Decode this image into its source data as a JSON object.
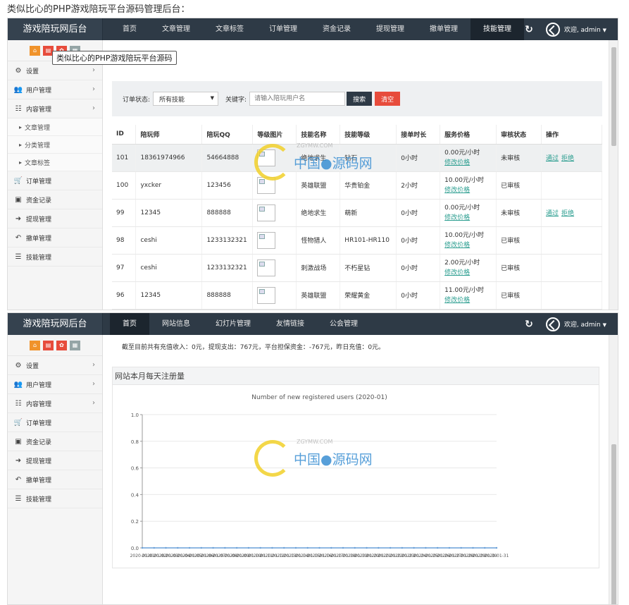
{
  "page": {
    "heading": "类似比心的PHP游戏陪玩平台源码管理后台："
  },
  "app": {
    "brand": "游戏陪玩网后台",
    "welcome": "欢迎, admin",
    "caret": "▼"
  },
  "shot1": {
    "nav": [
      "首页",
      "文章管理",
      "文章标签",
      "订单管理",
      "资金记录",
      "提现管理",
      "撤单管理",
      "技能管理"
    ],
    "active_nav": 7,
    "tooltip": "类似比心的PHP游戏陪玩平台源码",
    "sidebar": [
      {
        "label": "设置",
        "icon": "⚙"
      },
      {
        "label": "用户管理",
        "icon": "👥"
      },
      {
        "label": "内容管理",
        "icon": "☷"
      }
    ],
    "subitems": [
      "文章管理",
      "分类管理",
      "文章标签"
    ],
    "sidebar_rest": [
      {
        "label": "订单管理",
        "icon": "🛒"
      },
      {
        "label": "资金记录",
        "icon": "▣"
      },
      {
        "label": "提现管理",
        "icon": "➜"
      },
      {
        "label": "撤单管理",
        "icon": "↶"
      },
      {
        "label": "技能管理",
        "icon": "☰"
      }
    ],
    "filter": {
      "status_label": "订单状态:",
      "status_value": "所有技能",
      "keyword_label": "关键字:",
      "keyword_placeholder": "请输入陪玩用户名",
      "search_btn": "搜索",
      "clear_btn": "清空"
    },
    "table": {
      "headers": [
        "ID",
        "陪玩师",
        "陪玩QQ",
        "等级图片",
        "技能名称",
        "技能等级",
        "接单时长",
        "服务价格",
        "审核状态",
        "操作"
      ],
      "rows": [
        {
          "id": "101",
          "player": "18361974966",
          "qq": "54664888",
          "skill": "绝地求生",
          "level": "钻石",
          "duration": "0小时",
          "price": "0.00元/小时",
          "edit": "修改价格",
          "status": "未审核",
          "ops": [
            "通过",
            "拒绝"
          ]
        },
        {
          "id": "100",
          "player": "yxcker",
          "qq": "123456",
          "skill": "英雄联盟",
          "level": "华贵铂金",
          "duration": "2小时",
          "price": "10.00元/小时",
          "edit": "修改价格",
          "status": "已审核",
          "ops": []
        },
        {
          "id": "99",
          "player": "12345",
          "qq": "888888",
          "skill": "绝地求生",
          "level": "萌新",
          "duration": "0小时",
          "price": "0.00元/小时",
          "edit": "修改价格",
          "status": "未审核",
          "ops": [
            "通过",
            "拒绝"
          ]
        },
        {
          "id": "98",
          "player": "ceshi",
          "qq": "1233132321",
          "skill": "怪物猎人",
          "level": "HR101-HR110",
          "duration": "0小时",
          "price": "10.00元/小时",
          "edit": "修改价格",
          "status": "已审核",
          "ops": []
        },
        {
          "id": "97",
          "player": "ceshi",
          "qq": "1233132321",
          "skill": "刺激战场",
          "level": "不朽星钻",
          "duration": "0小时",
          "price": "2.00元/小时",
          "edit": "修改价格",
          "status": "已审核",
          "ops": []
        },
        {
          "id": "96",
          "player": "12345",
          "qq": "888888",
          "skill": "英雄联盟",
          "level": "荣耀黄金",
          "duration": "0小时",
          "price": "11.00元/小时",
          "edit": "修改价格",
          "status": "已审核",
          "ops": []
        }
      ]
    }
  },
  "shot2": {
    "nav": [
      "首页",
      "网站信息",
      "幻灯片管理",
      "友情链接",
      "公会管理"
    ],
    "active_nav": 0,
    "sidebar": [
      {
        "label": "设置",
        "icon": "⚙"
      },
      {
        "label": "用户管理",
        "icon": "👥"
      },
      {
        "label": "内容管理",
        "icon": "☷"
      },
      {
        "label": "订单管理",
        "icon": "🛒"
      },
      {
        "label": "资金记录",
        "icon": "▣"
      },
      {
        "label": "提现管理",
        "icon": "➜"
      },
      {
        "label": "撤单管理",
        "icon": "↶"
      },
      {
        "label": "技能管理",
        "icon": "☰"
      }
    ],
    "summary": "截至目前共有充值收入：0元，提现支出：767元，平台担保资金：-767元，昨日充值：0元。",
    "panel_title": "网站本月每天注册量"
  },
  "chart_data": {
    "type": "line",
    "title": "Number of new registered users (2020-01)",
    "x": [
      "2020-01-01",
      "2020-01-02",
      "2020-01-03",
      "2020-01-04",
      "2020-01-05",
      "2020-01-06",
      "2020-01-07",
      "2020-01-08",
      "2020-01-09",
      "2020-01-10",
      "2020-01-11",
      "2020-01-12",
      "2020-01-13",
      "2020-01-14",
      "2020-01-15",
      "2020-01-16",
      "2020-01-17",
      "2020-01-18",
      "2020-01-19",
      "2020-01-20",
      "2020-01-21",
      "2020-01-22",
      "2020-01-23",
      "2020-01-24",
      "2020-01-25",
      "2020-01-26",
      "2020-01-27",
      "2020-01-28",
      "2020-01-29",
      "2020-01-30",
      "2020-01-31"
    ],
    "series": [
      {
        "values": [
          0,
          0,
          0,
          0,
          0,
          0,
          0,
          0,
          0,
          0,
          0,
          0,
          0,
          0,
          0,
          0,
          0,
          0,
          0,
          0,
          0,
          0,
          0,
          0,
          0,
          0,
          0,
          0,
          0,
          0,
          0
        ]
      }
    ],
    "yticks": [
      "0.0",
      "0.2",
      "0.4",
      "0.6",
      "0.8",
      "1.0"
    ],
    "ylim": [
      0,
      1
    ],
    "grid": true,
    "xlabel": "",
    "ylabel": ""
  },
  "watermark": {
    "text": "中国●源码网",
    "small": "ZGYMW.COM"
  },
  "colors": {
    "topbar": "#2e3a46",
    "accent": "#2a9d8f",
    "danger": "#e74c3c",
    "orange": "#f0932b"
  }
}
